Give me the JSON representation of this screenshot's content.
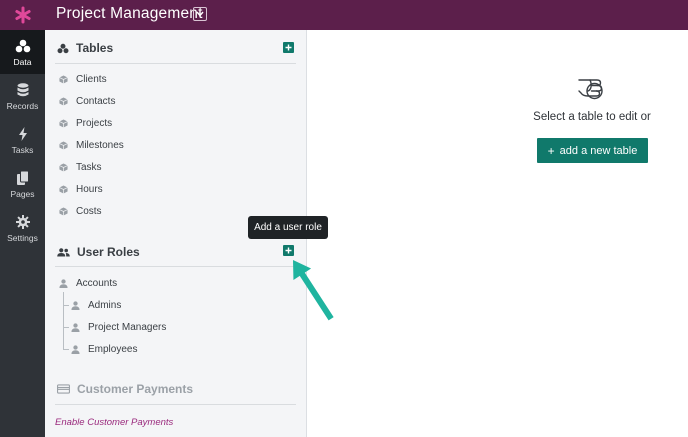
{
  "header": {
    "title": "Project Management"
  },
  "nav": [
    {
      "label": "Data",
      "icon": "data-icon"
    },
    {
      "label": "Records",
      "icon": "database-icon"
    },
    {
      "label": "Tasks",
      "icon": "bolt-icon"
    },
    {
      "label": "Pages",
      "icon": "pages-icon"
    },
    {
      "label": "Settings",
      "icon": "gear-icon"
    }
  ],
  "sidebar": {
    "tables": {
      "title": "Tables",
      "items": [
        "Clients",
        "Contacts",
        "Projects",
        "Milestones",
        "Tasks",
        "Hours",
        "Costs"
      ]
    },
    "user_roles": {
      "title": "User Roles",
      "items": [
        "Accounts",
        "Admins",
        "Project Managers",
        "Employees"
      ]
    },
    "customer_payments": {
      "title": "Customer Payments",
      "link": "Enable Customer Payments"
    }
  },
  "tooltip": "Add a user role",
  "main": {
    "prompt": "Select a table to edit or",
    "button_label": "add a new table"
  },
  "colors": {
    "topbar": "#5c1f4b",
    "accent": "#10796b",
    "arrow": "#1fb49f",
    "link": "#9a2a7d"
  }
}
